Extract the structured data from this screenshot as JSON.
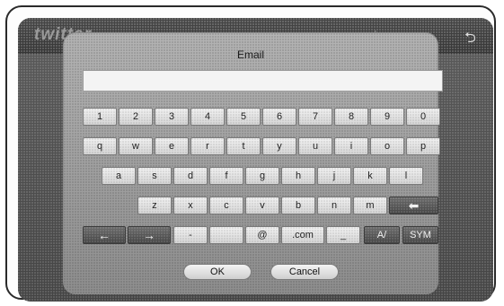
{
  "app": {
    "logo_text": "twitter"
  },
  "topbar": {
    "back_symbol": "⮌"
  },
  "dialog": {
    "title": "Email",
    "input_value": "",
    "ok_label": "OK",
    "cancel_label": "Cancel"
  },
  "keys": {
    "row1": [
      "1",
      "2",
      "3",
      "4",
      "5",
      "6",
      "7",
      "8",
      "9",
      "0"
    ],
    "row2": [
      "q",
      "w",
      "e",
      "r",
      "t",
      "y",
      "u",
      "i",
      "o",
      "p"
    ],
    "row3": [
      "a",
      "s",
      "d",
      "f",
      "g",
      "h",
      "j",
      "k",
      "l"
    ],
    "row4": [
      "z",
      "x",
      "c",
      "v",
      "b",
      "n",
      "m"
    ],
    "backspace": "⬅",
    "left_arrow": "←",
    "right_arrow": "→",
    "dash": "-",
    "blank": "",
    "at": "@",
    ".com": ".com",
    "underscore": "_",
    "case": "A/",
    "sym": "SYM"
  }
}
